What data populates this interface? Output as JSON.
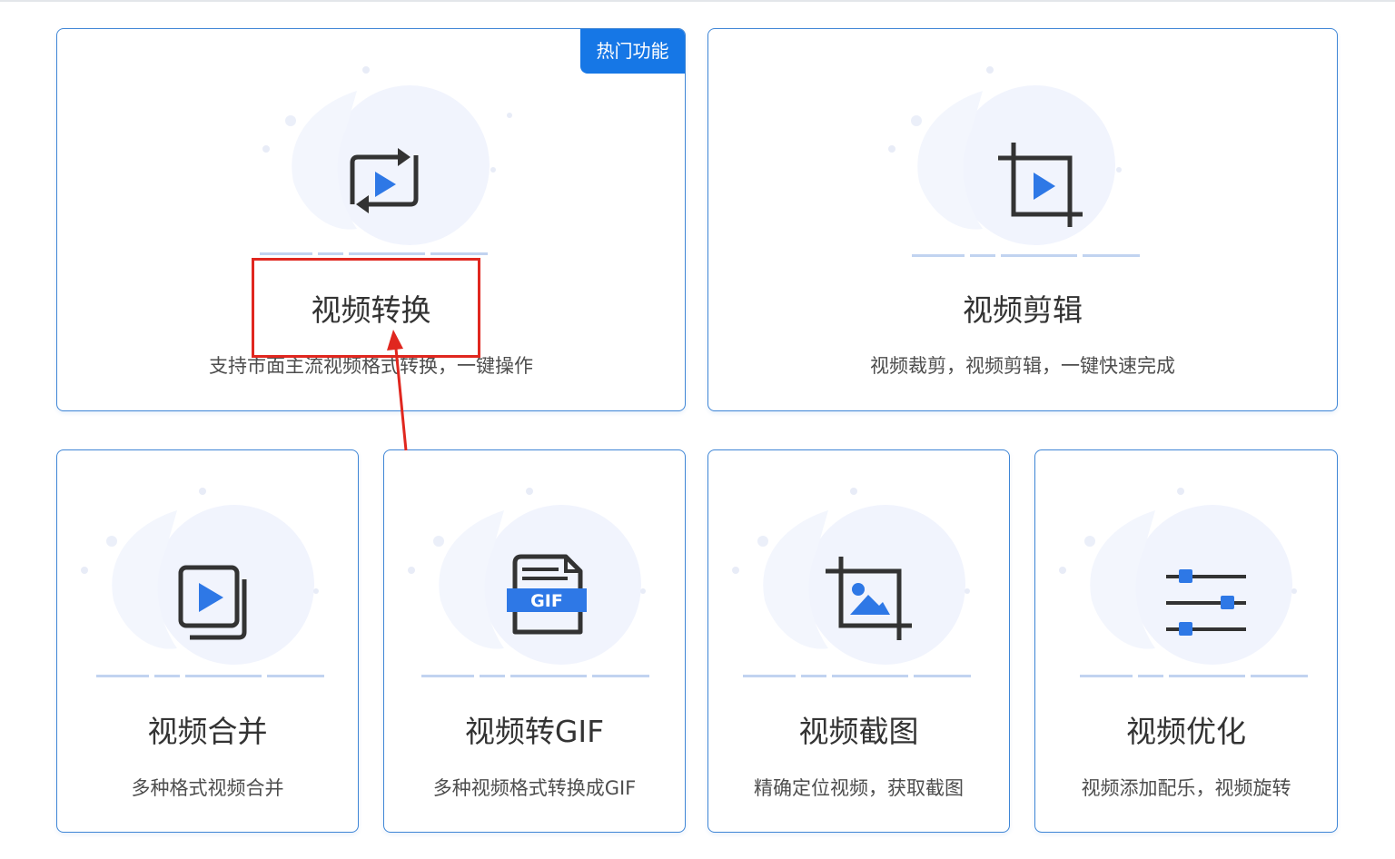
{
  "theme": {
    "accent": "#3f86d6",
    "icon_blue": "#2e78e6",
    "icon_dark": "#333333",
    "annotation": "#e0271f"
  },
  "cards": [
    {
      "key": "convert",
      "title": "视频转换",
      "desc": "支持市面主流视频格式转换，一键操作",
      "badge": "热门功能",
      "icon": "convert-icon"
    },
    {
      "key": "clip",
      "title": "视频剪辑",
      "desc": "视频裁剪，视频剪辑，一键快速完成",
      "icon": "crop-video-icon"
    },
    {
      "key": "merge",
      "title": "视频合并",
      "desc": "多种格式视频合并",
      "icon": "merge-icon"
    },
    {
      "key": "gif",
      "title": "视频转GIF",
      "desc": "多种视频格式转换成GIF",
      "icon": "gif-icon",
      "icon_text": "GIF"
    },
    {
      "key": "screenshot",
      "title": "视频截图",
      "desc": "精确定位视频，获取截图",
      "icon": "screenshot-icon"
    },
    {
      "key": "optimize",
      "title": "视频优化",
      "desc": "视频添加配乐，视频旋转",
      "icon": "sliders-icon"
    }
  ]
}
